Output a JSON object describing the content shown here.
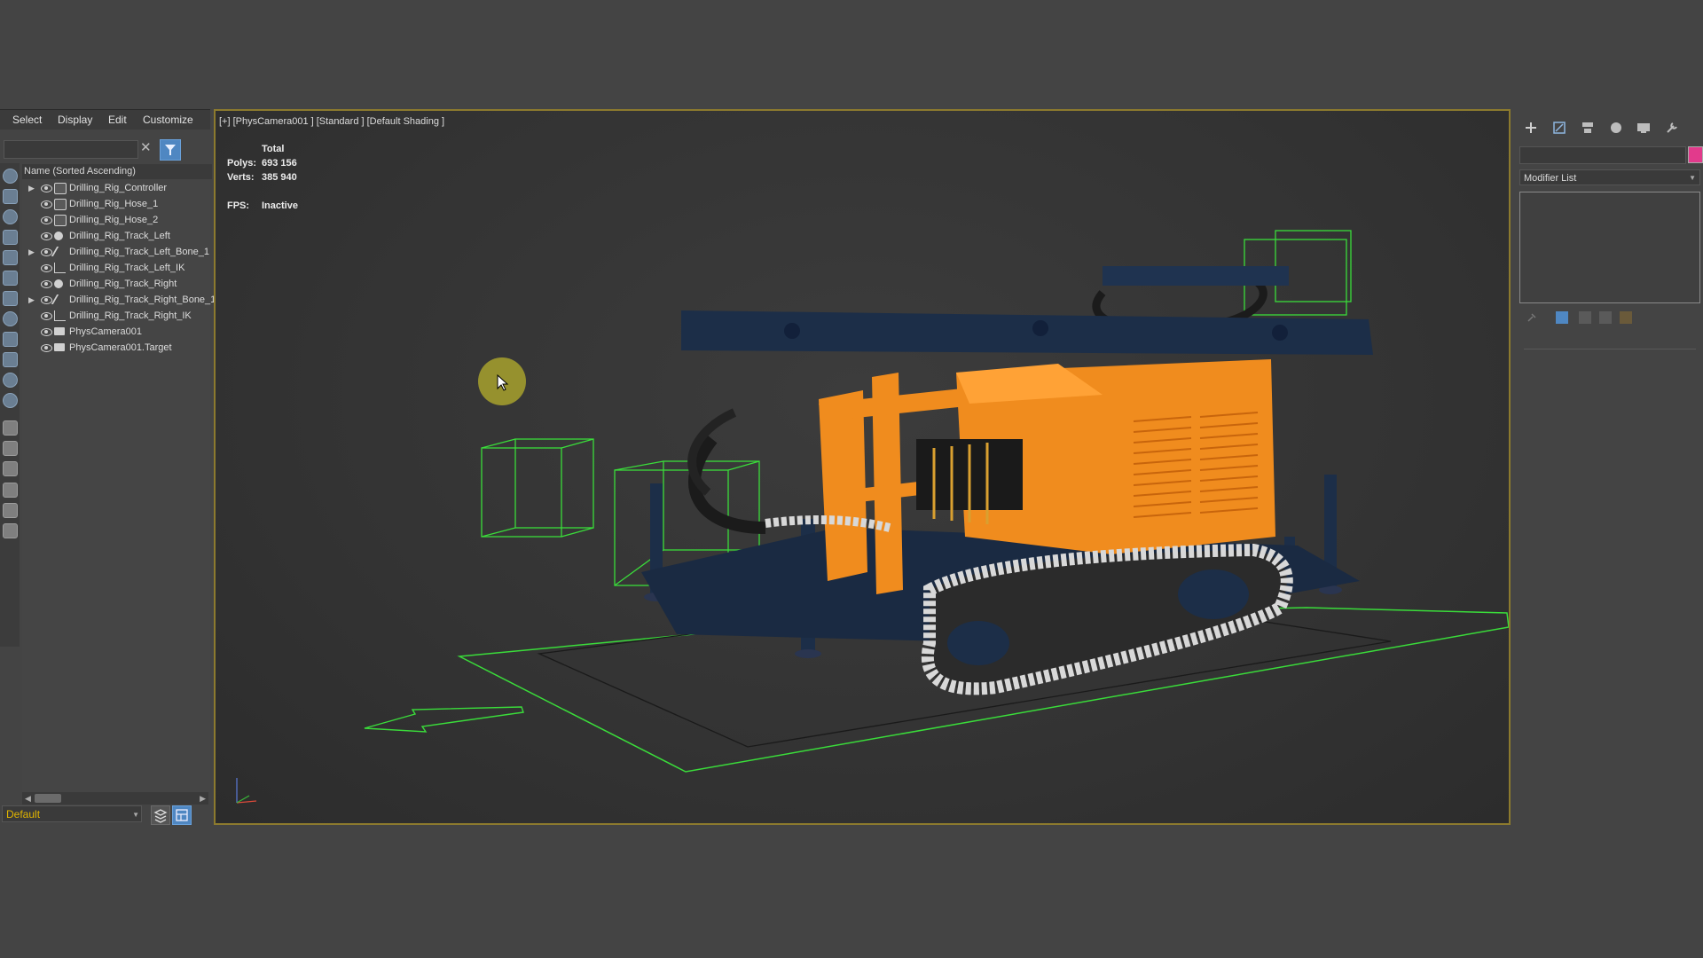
{
  "scene_explorer": {
    "menu": [
      "Select",
      "Display",
      "Edit",
      "Customize"
    ],
    "column_header": "Name (Sorted Ascending)",
    "objects": [
      {
        "name": "Drilling_Rig_Controller",
        "expandable": true,
        "icon": "controller-icon"
      },
      {
        "name": "Drilling_Rig_Hose_1",
        "expandable": false,
        "icon": "controller-icon"
      },
      {
        "name": "Drilling_Rig_Hose_2",
        "expandable": false,
        "icon": "controller-icon"
      },
      {
        "name": "Drilling_Rig_Track_Left",
        "expandable": false,
        "icon": "mesh-icon"
      },
      {
        "name": "Drilling_Rig_Track_Left_Bone_1",
        "expandable": true,
        "icon": "bone-icon"
      },
      {
        "name": "Drilling_Rig_Track_Left_IK",
        "expandable": false,
        "icon": "ik-icon"
      },
      {
        "name": "Drilling_Rig_Track_Right",
        "expandable": false,
        "icon": "mesh-icon"
      },
      {
        "name": "Drilling_Rig_Track_Right_Bone_1",
        "expandable": true,
        "icon": "bone-icon"
      },
      {
        "name": "Drilling_Rig_Track_Right_IK",
        "expandable": false,
        "icon": "ik-icon"
      },
      {
        "name": "PhysCamera001",
        "expandable": false,
        "icon": "camera-icon"
      },
      {
        "name": "PhysCamera001.Target",
        "expandable": false,
        "icon": "camera-icon"
      }
    ],
    "layer": "Default"
  },
  "viewport": {
    "label": "[+] [PhysCamera001 ] [Standard ] [Default Shading ]",
    "stats": {
      "total_label": "Total",
      "polys_label": "Polys:",
      "polys_value": "693 156",
      "verts_label": "Verts:",
      "verts_value": "385 940",
      "fps_label": "FPS:",
      "fps_value": "Inactive"
    }
  },
  "command_panel": {
    "tabs": [
      "create-icon",
      "modify-icon",
      "hierarchy-icon",
      "motion-icon",
      "display-icon",
      "utilities-icon"
    ],
    "modifier_list": "Modifier List",
    "object_color": "#e23a8c"
  },
  "colors": {
    "viewport_border": "#8c7a2e",
    "rig_orange": "#f08c1e",
    "rig_navy": "#1c2e48",
    "helper_green": "#3adc3a",
    "accent_blue": "#4f87c2"
  }
}
